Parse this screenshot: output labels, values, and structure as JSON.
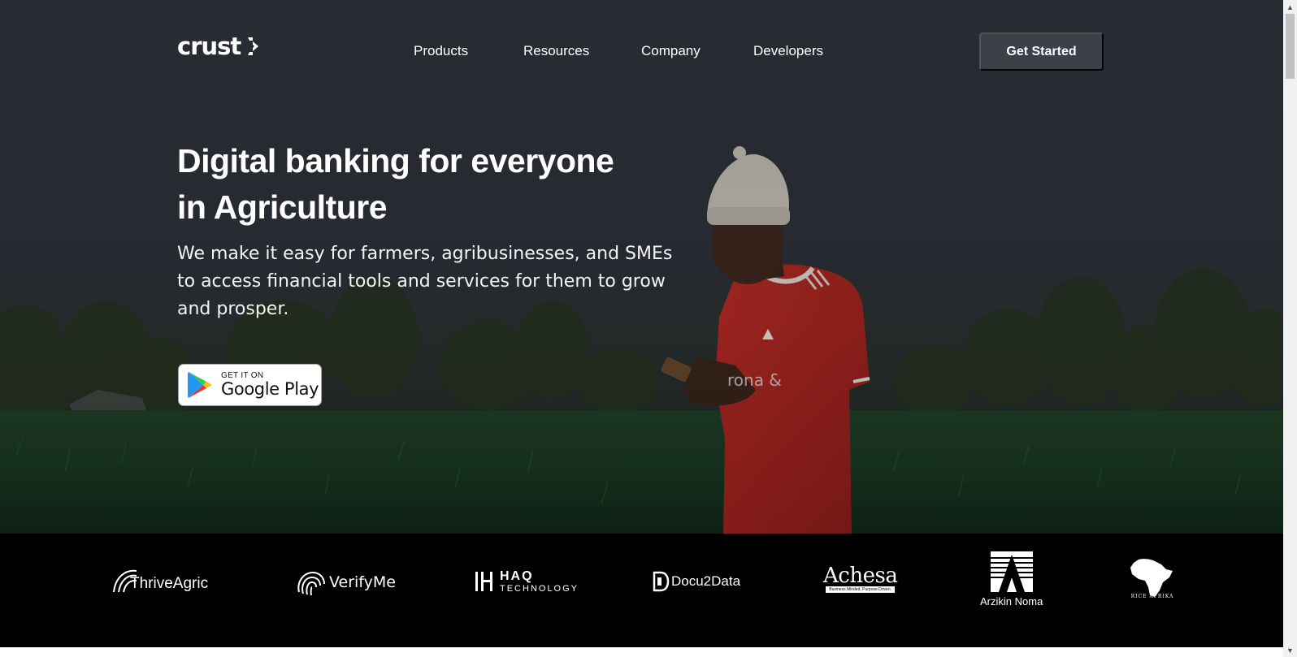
{
  "brand": {
    "name": "crust"
  },
  "nav": {
    "items": [
      {
        "label": "Products"
      },
      {
        "label": "Resources"
      },
      {
        "label": "Company"
      },
      {
        "label": "Developers"
      }
    ],
    "cta_label": "Get Started"
  },
  "hero": {
    "headline_line1": "Digital banking for everyone",
    "headline_line2": "in Agriculture",
    "subtext": "We make it easy for farmers, agribusinesses, and SMEs to access financial tools and services for them to grow and prosper.",
    "store_badge": {
      "small": "GET IT ON",
      "big": "Google Play"
    }
  },
  "partners": {
    "logos": [
      {
        "name": "ThriveAgric"
      },
      {
        "name": "VerifyMe"
      },
      {
        "name": "HAQ",
        "sub": "TECHNOLOGY"
      },
      {
        "name": "Docu2Data"
      },
      {
        "name": "Achesa",
        "tagline": "Business Minded, Purpose Driven."
      },
      {
        "name": "Arzikin Noma"
      },
      {
        "name": "RICE AFRIKA"
      }
    ]
  },
  "colors": {
    "cta_bg": "#3b4049",
    "partners_bg": "#000000",
    "text": "#ffffff"
  }
}
